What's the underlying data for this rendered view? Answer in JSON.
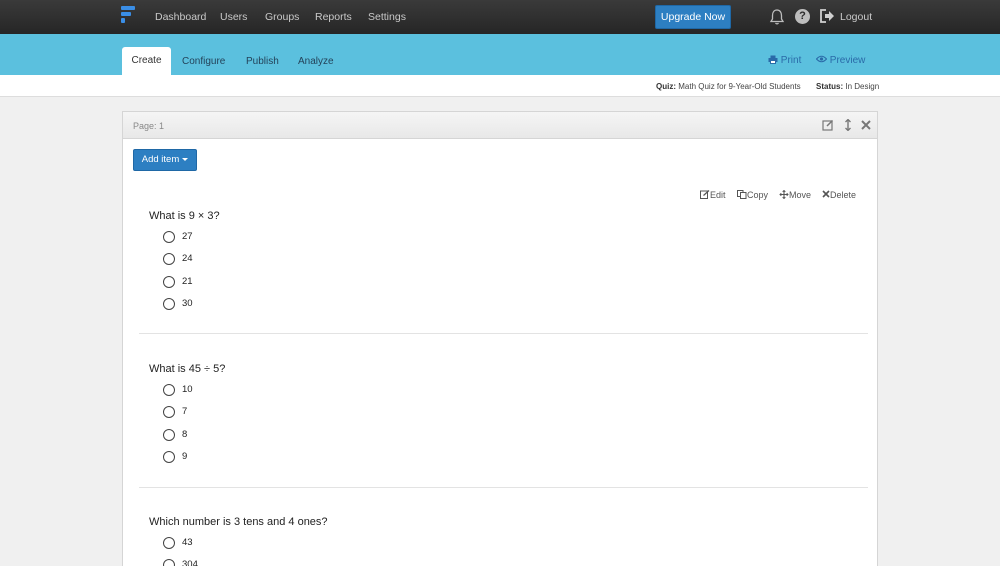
{
  "topnav": {
    "links": [
      "Dashboard",
      "Users",
      "Groups",
      "Reports",
      "Settings"
    ],
    "upgrade_label": "Upgrade Now",
    "logout_label": "Logout"
  },
  "tabs": [
    "Create",
    "Configure",
    "Publish",
    "Analyze"
  ],
  "actions": {
    "print": "Print",
    "preview": "Preview"
  },
  "info": {
    "quiz_label": "Quiz:",
    "quiz_name": "Math Quiz for 9-Year-Old Students",
    "status_label": "Status:",
    "status_value": "In Design"
  },
  "panel": {
    "page_label": "Page: 1",
    "add_item_label": "Add item",
    "item_actions": [
      "Edit",
      "Copy",
      "Move",
      "Delete"
    ]
  },
  "questions": [
    {
      "text": "What is 9 × 3?",
      "options": [
        "27",
        "24",
        "21",
        "30"
      ]
    },
    {
      "text": "What is 45 ÷ 5?",
      "options": [
        "10",
        "7",
        "8",
        "9"
      ]
    },
    {
      "text": "Which number is 3 tens and 4 ones?",
      "options": [
        "43",
        "304"
      ]
    }
  ],
  "colors": {
    "accent": "#2d7fc2",
    "bluebar": "#5bc0de",
    "topbar": "#2b2b2b"
  }
}
